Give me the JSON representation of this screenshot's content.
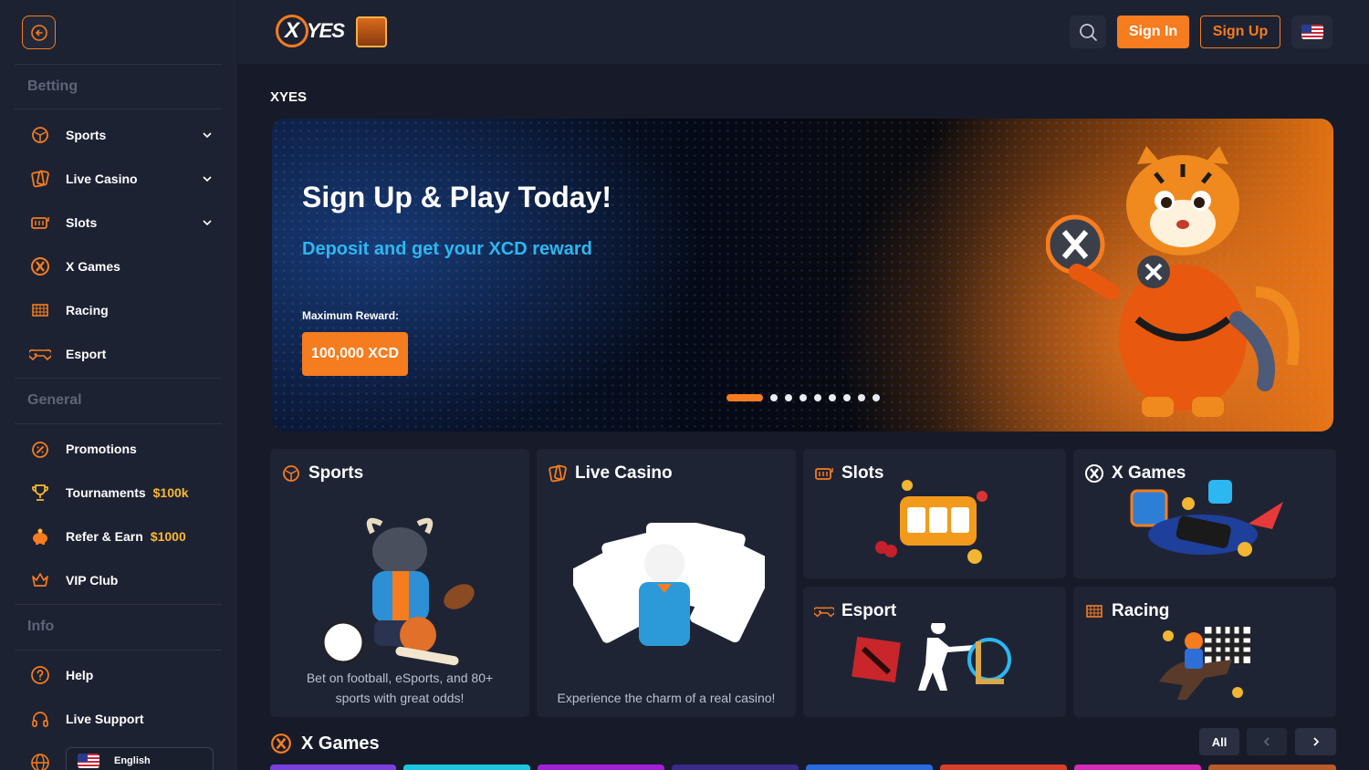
{
  "header": {
    "logo_text": "YES",
    "logo_mark": "X",
    "signin_label": "Sign In",
    "signup_label": "Sign Up",
    "search_icon": "search-icon",
    "language_flag": "us-flag-icon"
  },
  "sidebar": {
    "sections": {
      "betting": "Betting",
      "general": "General",
      "info": "Info"
    },
    "betting_items": [
      {
        "label": "Sports",
        "icon": "sports-icon",
        "expandable": true
      },
      {
        "label": "Live Casino",
        "icon": "cards-icon",
        "expandable": true
      },
      {
        "label": "Slots",
        "icon": "slots-icon",
        "expandable": true
      },
      {
        "label": "X Games",
        "icon": "x-games-icon",
        "expandable": false
      },
      {
        "label": "Racing",
        "icon": "racing-flag-icon",
        "expandable": false
      },
      {
        "label": "Esport",
        "icon": "gamepad-icon",
        "expandable": false
      }
    ],
    "general_items": [
      {
        "label": "Promotions",
        "icon": "promotions-icon",
        "extra": ""
      },
      {
        "label": "Tournaments",
        "icon": "trophy-icon",
        "extra": "$100k"
      },
      {
        "label": "Refer & Earn",
        "icon": "piggy-bank-icon",
        "extra": "$1000"
      },
      {
        "label": "VIP Club",
        "icon": "crown-icon",
        "extra": ""
      }
    ],
    "info_items": [
      {
        "label": "Help",
        "icon": "help-icon"
      },
      {
        "label": "Live Support",
        "icon": "headset-icon"
      }
    ],
    "language": "English"
  },
  "main": {
    "breadcrumb": "XYES",
    "banner": {
      "title": "Sign Up & Play Today!",
      "subtitle": "Deposit and get your XCD reward",
      "max_label": "Maximum Reward:",
      "reward": "100,000 XCD",
      "slide_count": 9,
      "active_slide": 1
    },
    "cards": {
      "sports": {
        "title": "Sports",
        "desc": "Bet on football, eSports, and 80+ sports with great odds!"
      },
      "live_casino": {
        "title": "Live Casino",
        "desc": "Experience the charm of a real casino!"
      },
      "slots": {
        "title": "Slots"
      },
      "x_games": {
        "title": "X Games"
      },
      "esport": {
        "title": "Esport"
      },
      "racing": {
        "title": "Racing"
      }
    },
    "x_games_section": {
      "title": "X Games",
      "all_label": "All"
    }
  },
  "colors": {
    "accent": "#f57c1f",
    "gold": "#f9b832",
    "link_blue": "#2db7f0",
    "background": "#171b29",
    "panel": "#1d2232"
  }
}
